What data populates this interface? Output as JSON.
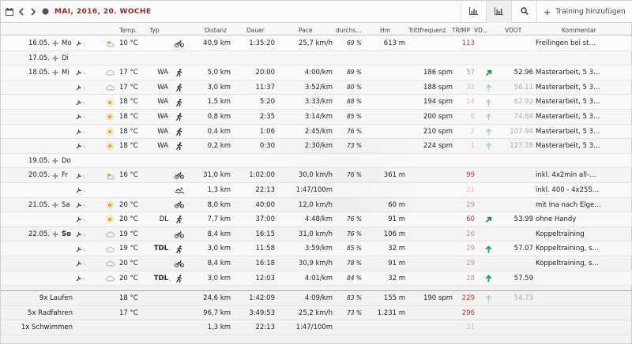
{
  "toolbar": {
    "title": "MAI, 2016, 20. WOCHE",
    "add_label": "Training hinzufügen"
  },
  "columns": {
    "temp": "Temp.",
    "typ": "Typ",
    "distanz": "Distanz",
    "dauer": "Dauer",
    "pace": "Pace",
    "durchs": "durchs…",
    "hm": "Hm",
    "tritt": "Trittfrequenz",
    "trimp": "TRIMP",
    "vd": "VD…",
    "vdot": "VDOT",
    "kommentar": "Kommentar"
  },
  "rows": [
    {
      "date": "16.05.",
      "day": "Mo",
      "weather": "sun-cloud",
      "temp": "10 °C",
      "typ": "",
      "sport": "bike",
      "dist": "40,9 km",
      "dur": "1:35:20",
      "pace": "25,7 km/h",
      "hr": "69 %",
      "hm": "613 m",
      "cad": "",
      "trimp": "113",
      "trimp_color": "red",
      "vd": "",
      "vdot": "",
      "comment": "Freilingen bei st…",
      "has_plus": true,
      "has_wrench": true
    },
    {
      "date": "17.05.",
      "day": "Di",
      "weather": "",
      "temp": "",
      "typ": "",
      "sport": "",
      "dist": "",
      "dur": "",
      "pace": "",
      "hr": "",
      "hm": "",
      "cad": "",
      "trimp": "",
      "trimp_color": "",
      "vd": "",
      "vdot": "",
      "comment": "",
      "has_plus": true,
      "has_wrench": false
    },
    {
      "date": "18.05.",
      "day": "Mi",
      "weather": "cloud",
      "temp": "17 °C",
      "typ": "WA",
      "sport": "run",
      "dist": "5,0 km",
      "dur": "20:00",
      "pace": "4:00/km",
      "hr": "89 %",
      "hm": "",
      "cad": "186 spm",
      "trimp": "57",
      "trimp_color": "pink",
      "vd": "dg",
      "vdot": "52.96",
      "vdot_light": false,
      "comment": "Masterarbeit, 5 3…",
      "has_plus": true,
      "has_wrench": true
    },
    {
      "date": "",
      "day": "",
      "weather": "cloud",
      "temp": "17 °C",
      "typ": "WA",
      "sport": "run",
      "dist": "3,0 km",
      "dur": "11:37",
      "pace": "3:52/km",
      "hr": "80 %",
      "hm": "",
      "cad": "188 spm",
      "trimp": "32",
      "trimp_color": "lightpink",
      "vd": "lg",
      "vdot": "56.11",
      "vdot_light": true,
      "comment": "Masterarbeit, 5 3…",
      "has_plus": false,
      "has_wrench": true
    },
    {
      "date": "",
      "day": "",
      "weather": "sun",
      "temp": "18 °C",
      "typ": "WA",
      "sport": "run",
      "dist": "1,5 km",
      "dur": "5:20",
      "pace": "3:33/km",
      "hr": "88 %",
      "hm": "",
      "cad": "194 spm",
      "trimp": "14",
      "trimp_color": "lightpink",
      "vd": "lg",
      "vdot": "62.92",
      "vdot_light": true,
      "comment": "Masterarbeit, 5 3…",
      "has_plus": false,
      "has_wrench": true
    },
    {
      "date": "",
      "day": "",
      "weather": "sun",
      "temp": "18 °C",
      "typ": "WA",
      "sport": "run",
      "dist": "0,8 km",
      "dur": "2:35",
      "pace": "3:14/km",
      "hr": "85 %",
      "hm": "",
      "cad": "200 spm",
      "trimp": "6",
      "trimp_color": "lightpink",
      "vd": "lg",
      "vdot": "74.84",
      "vdot_light": true,
      "comment": "Masterarbeit, 5 3…",
      "has_plus": false,
      "has_wrench": true
    },
    {
      "date": "",
      "day": "",
      "weather": "sun",
      "temp": "18 °C",
      "typ": "WA",
      "sport": "run",
      "dist": "0,4 km",
      "dur": "1:06",
      "pace": "2:45/km",
      "hr": "76 %",
      "hm": "",
      "cad": "210 spm",
      "trimp": "2",
      "trimp_color": "lightpink",
      "vd": "lg",
      "vdot": "107.94",
      "vdot_light": true,
      "comment": "Masterarbeit, 5 3…",
      "has_plus": false,
      "has_wrench": true
    },
    {
      "date": "",
      "day": "",
      "weather": "sun",
      "temp": "18 °C",
      "typ": "WA",
      "sport": "run",
      "dist": "0,2 km",
      "dur": "0:30",
      "pace": "2:30/km",
      "hr": "73 %",
      "hm": "",
      "cad": "224 spm",
      "trimp": "1",
      "trimp_color": "lightpink",
      "vd": "lg",
      "vdot": "127.78",
      "vdot_light": true,
      "comment": "Masterarbeit, 5 3…",
      "has_plus": false,
      "has_wrench": true
    },
    {
      "date": "19.05.",
      "day": "Do",
      "weather": "",
      "temp": "",
      "typ": "",
      "sport": "",
      "dist": "",
      "dur": "",
      "pace": "",
      "hr": "",
      "hm": "",
      "cad": "",
      "trimp": "",
      "trimp_color": "",
      "vd": "",
      "vdot": "",
      "comment": "",
      "has_plus": true,
      "has_wrench": false
    },
    {
      "date": "20.05.",
      "day": "Fr",
      "weather": "sun-cloud",
      "temp": "16 °C",
      "typ": "",
      "sport": "bike",
      "dist": "31,0 km",
      "dur": "1:02:00",
      "pace": "30,0 km/h",
      "hr": "76 %",
      "hm": "361 m",
      "cad": "",
      "trimp": "99",
      "trimp_color": "red",
      "vd": "",
      "vdot": "",
      "comment": "inkl. 4x2min all-…",
      "has_plus": true,
      "has_wrench": true
    },
    {
      "date": "",
      "day": "",
      "weather": "",
      "temp": "",
      "typ": "",
      "sport": "swim",
      "dist": "1,3 km",
      "dur": "22:13",
      "pace": "1:47/100m",
      "hr": "",
      "hm": "",
      "cad": "",
      "trimp": "21",
      "trimp_color": "lightpink",
      "vd": "",
      "vdot": "",
      "comment": "inkl. 400 - 4x25S…",
      "has_plus": false,
      "has_wrench": true
    },
    {
      "date": "21.05.",
      "day": "Sa",
      "weather": "sun",
      "temp": "20 °C",
      "typ": "",
      "sport": "bike",
      "dist": "8,0 km",
      "dur": "40:00",
      "pace": "12,0 km/h",
      "hr": "",
      "hm": "60 m",
      "cad": "",
      "trimp": "29",
      "trimp_color": "pink",
      "vd": "",
      "vdot": "",
      "comment": "mit Ina nach Elge…",
      "has_plus": true,
      "has_wrench": true
    },
    {
      "date": "",
      "day": "",
      "weather": "sun",
      "temp": "20 °C",
      "typ": "DL",
      "sport": "run",
      "dist": "7,7 km",
      "dur": "37:00",
      "pace": "4:48/km",
      "hr": "76 %",
      "hm": "91 m",
      "cad": "",
      "trimp": "60",
      "trimp_color": "red",
      "vd": "dg",
      "vdot": "53.99",
      "vdot_light": false,
      "comment": "ohne Handy",
      "has_plus": false,
      "has_wrench": true
    },
    {
      "date": "22.05.",
      "day": "So",
      "day_bold": true,
      "weather": "cloud",
      "temp": "19 °C",
      "typ": "",
      "sport": "bike",
      "dist": "8,4 km",
      "dur": "16:15",
      "pace": "31,0 km/h",
      "hr": "76 %",
      "hm": "106 m",
      "cad": "",
      "trimp": "26",
      "trimp_color": "pink",
      "vd": "",
      "vdot": "",
      "comment": "Koppeltraining",
      "has_plus": true,
      "has_wrench": true
    },
    {
      "date": "",
      "day": "",
      "weather": "cloud",
      "temp": "19 °C",
      "typ": "TDL",
      "typ_bold": true,
      "sport": "run",
      "dist": "3,0 km",
      "dur": "11:58",
      "pace": "3:59/km",
      "hr": "85 %",
      "hm": "32 m",
      "cad": "",
      "trimp": "29",
      "trimp_color": "pink",
      "vd": "g",
      "vdot": "57.07",
      "vdot_light": false,
      "comment": "Koppeltraining, s…",
      "has_plus": false,
      "has_wrench": true
    },
    {
      "date": "",
      "day": "",
      "weather": "cloud",
      "temp": "20 °C",
      "typ": "",
      "sport": "bike",
      "dist": "8,4 km",
      "dur": "16:18",
      "pace": "30,9 km/h",
      "hr": "78 %",
      "hm": "91 m",
      "cad": "",
      "trimp": "29",
      "trimp_color": "pink",
      "vd": "",
      "vdot": "",
      "comment": "Koppeltraining, s…",
      "has_plus": false,
      "has_wrench": true
    },
    {
      "date": "",
      "day": "",
      "weather": "cloud",
      "temp": "20 °C",
      "typ": "TDL",
      "typ_bold": true,
      "sport": "run",
      "dist": "3,0 km",
      "dur": "12:03",
      "pace": "4:01/km",
      "hr": "84 %",
      "hm": "32 m",
      "cad": "",
      "trimp": "28",
      "trimp_color": "pink",
      "vd": "g",
      "vdot": "57.59",
      "vdot_light": false,
      "comment": "",
      "has_plus": false,
      "has_wrench": true
    }
  ],
  "summary": [
    {
      "label": "9x Laufen",
      "temp": "18 °C",
      "dist": "24,6 km",
      "dur": "1:42:09",
      "pace": "4:09/km",
      "hr": "83 %",
      "hm": "155 m",
      "cad": "190 spm",
      "trimp": "229",
      "trimp_color": "red",
      "vd": "lg",
      "vdot": "54.73",
      "vdot_light": true
    },
    {
      "label": "5x Radfahren",
      "temp": "17 °C",
      "dist": "96,7 km",
      "dur": "3:49:53",
      "pace": "25,2 km/h",
      "hr": "73 %",
      "hm": "1.231 m",
      "cad": "",
      "trimp": "296",
      "trimp_color": "red",
      "vd": "",
      "vdot": "",
      "vdot_light": false
    },
    {
      "label": "1x Schwimmen",
      "temp": "",
      "dist": "1,3 km",
      "dur": "22:13",
      "pace": "1:47/100m",
      "hr": "",
      "hm": "",
      "cad": "",
      "trimp": "21",
      "trimp_color": "lightpink",
      "vd": "",
      "vdot": "",
      "vdot_light": false
    }
  ]
}
